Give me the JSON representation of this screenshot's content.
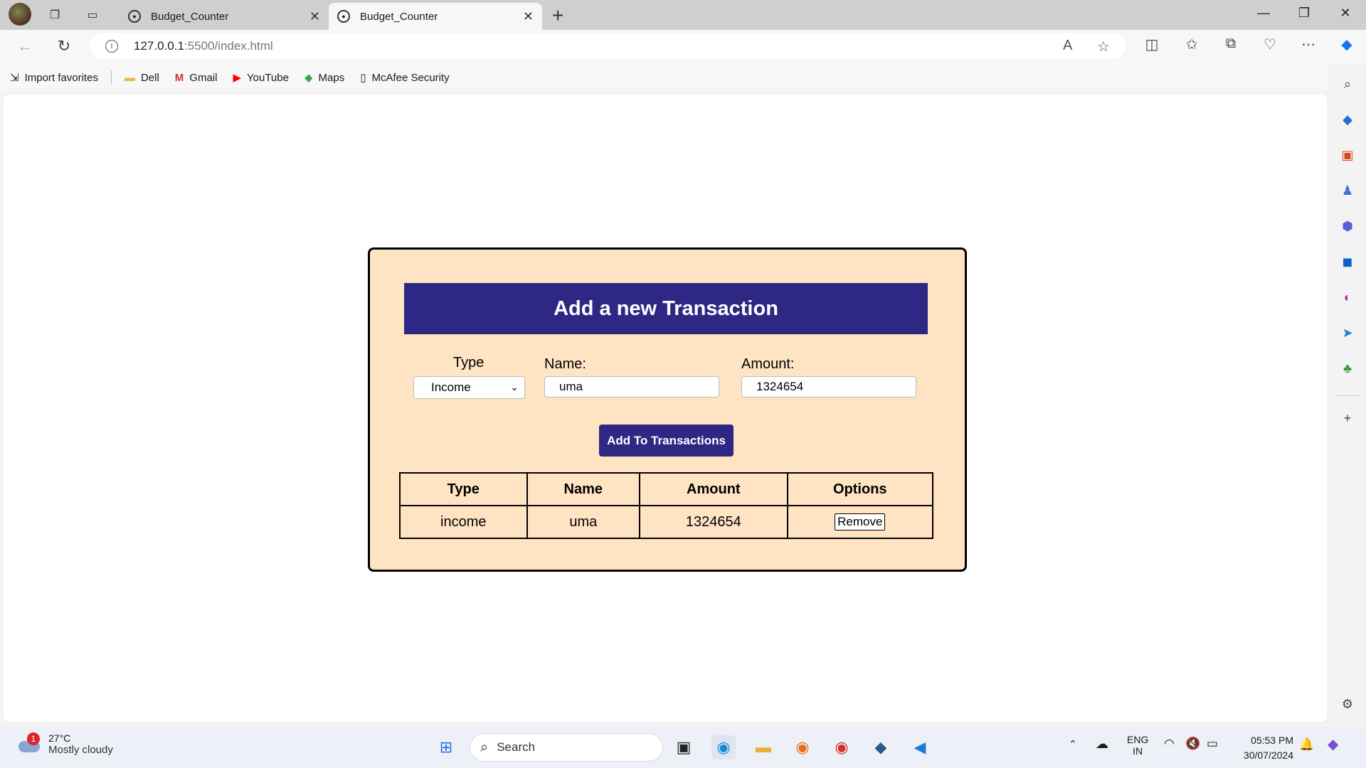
{
  "browser": {
    "tabs": [
      {
        "title": "Budget_Counter",
        "active": false
      },
      {
        "title": "Budget_Counter",
        "active": true
      }
    ],
    "url_host": "127.0.0.1",
    "url_path": ":5500/index.html",
    "favorites": [
      "Import favorites",
      "Dell",
      "Gmail",
      "YouTube",
      "Maps",
      "McAfee Security"
    ]
  },
  "form": {
    "title": "Add a new Transaction",
    "type_label": "Type",
    "type_value": "Income",
    "name_label": "Name:",
    "name_value": "uma",
    "amount_label": "Amount:",
    "amount_value": "1324654",
    "add_button": "Add To Transactions"
  },
  "table": {
    "headers": [
      "Type",
      "Name",
      "Amount",
      "Options"
    ],
    "rows": [
      {
        "type": "income",
        "name": "uma",
        "amount": "1324654",
        "option": "Remove"
      }
    ]
  },
  "taskbar": {
    "weather_badge": "1",
    "temperature": "27°C",
    "condition": "Mostly cloudy",
    "search_placeholder": "Search",
    "lang1": "ENG",
    "lang2": "IN",
    "time": "05:53 PM",
    "date": "30/07/2024"
  },
  "colors": {
    "accent": "#2e2784",
    "card_bg": "#ffe4c4"
  }
}
